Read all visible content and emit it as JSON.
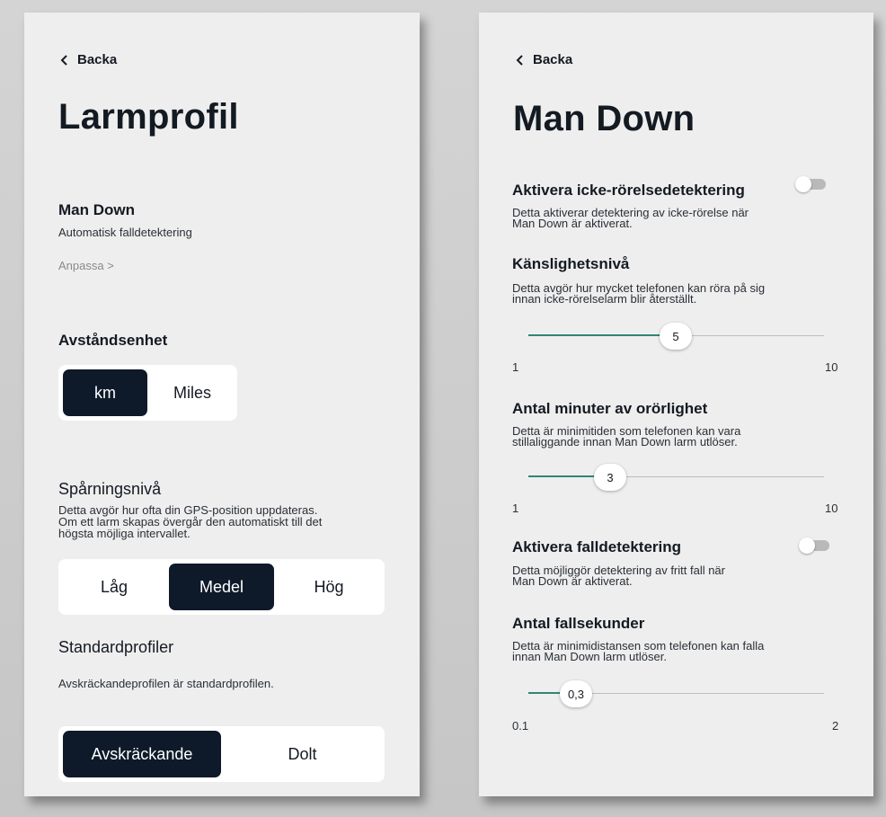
{
  "left": {
    "back_label": "Backa",
    "title": "Larmprofil",
    "man_down": {
      "heading": "Man Down",
      "subtitle": "Automatisk falldetektering",
      "customize_link": "Anpassa >"
    },
    "distance_unit": {
      "heading": "Avståndsenhet",
      "options": [
        "km",
        "Miles"
      ],
      "selected": "km"
    },
    "tracking": {
      "heading": "Spårningsnivå",
      "description": [
        "Detta avgör hur ofta din GPS-position uppdateras.",
        "Om ett larm skapas övergår den automatiskt till det",
        "högsta möjliga intervallet."
      ],
      "options": [
        "Låg",
        "Medel",
        "Hög"
      ],
      "selected": "Medel"
    },
    "standard_profiles": {
      "heading": "Standardprofiler",
      "description": "Avskräckandeprofilen är standardprofilen.",
      "options": [
        "Avskräckande",
        "Dolt"
      ],
      "selected": "Avskräckande"
    }
  },
  "right": {
    "back_label": "Backa",
    "title": "Man Down",
    "no_motion": {
      "heading": "Aktivera icke-rörelsedetektering",
      "description": [
        "Detta aktiverar detektering av icke-rörelse när",
        "Man Down är aktiverat."
      ],
      "enabled": false
    },
    "sensitivity": {
      "heading": "Känslighetsnivå",
      "description": [
        "Detta avgör hur mycket telefonen kan röra på sig",
        "innan icke-rörelselarm blir återställt."
      ],
      "value": 5,
      "value_label": "5",
      "min": 1,
      "max": 10,
      "min_label": "1",
      "max_label": "10"
    },
    "still_minutes": {
      "heading": "Antal minuter av orörlighet",
      "description": [
        "Detta är minimitiden som telefonen kan vara",
        "stillaliggande innan Man Down larm utlöser."
      ],
      "value": 3,
      "value_label": "3",
      "min": 1,
      "max": 10,
      "min_label": "1",
      "max_label": "10"
    },
    "fall_detection": {
      "heading": "Aktivera falldetektering",
      "description": [
        "Detta möjliggör detektering av fritt fall när",
        "Man Down är aktiverat."
      ],
      "enabled": false
    },
    "fall_seconds": {
      "heading": "Antal fallsekunder",
      "description": [
        "Detta är minimidistansen som telefonen kan falla",
        "innan Man Down larm utlöser."
      ],
      "value": 0.3,
      "value_label": "0,3",
      "min": 0.1,
      "max": 2,
      "min_label": "0.1",
      "max_label": "2"
    }
  },
  "colors": {
    "selected_bg": "#0e1a2a",
    "slider_fill": "#2f8673",
    "panel_bg": "#eeeeee",
    "toggle_off": "#b9b9b9"
  },
  "icons": {
    "back": "chevron-left-icon"
  }
}
